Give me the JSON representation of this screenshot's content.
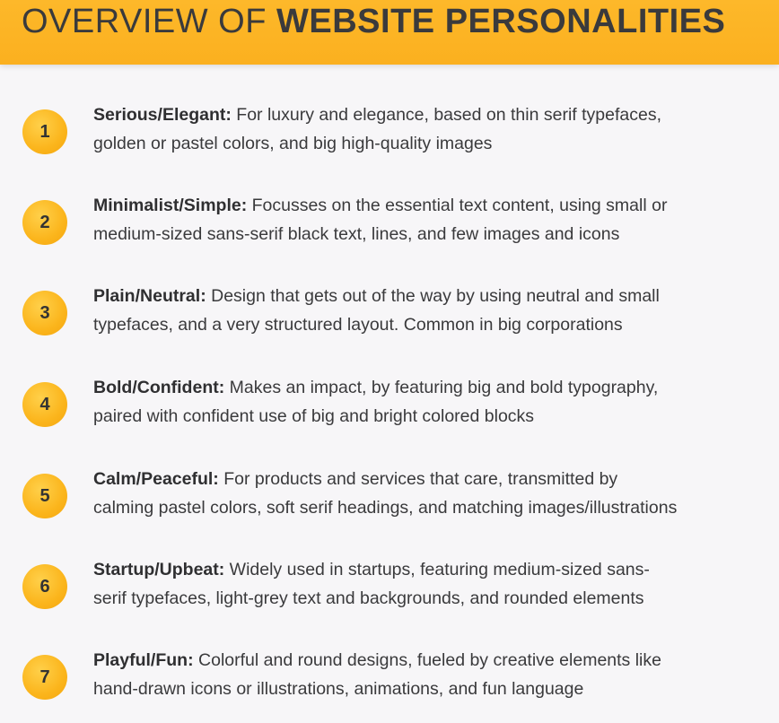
{
  "header": {
    "title_regular": "OVERVIEW OF",
    "title_bold": "WEBSITE PERSONALITIES",
    "background_color": "#fbb01f"
  },
  "items": [
    {
      "number": "1",
      "label": "Serious/Elegant:",
      "line1": "For luxury and elegance, based on thin serif typefaces,",
      "line2": "golden or pastel colors, and big high-quality images"
    },
    {
      "number": "2",
      "label": "Minimalist/Simple:",
      "line1": "Focusses on the essential text content, using small or",
      "line2": "medium-sized sans-serif black text, lines, and few images and icons"
    },
    {
      "number": "3",
      "label": "Plain/Neutral:",
      "line1": "Design that gets out of the way by using neutral and small",
      "line2": "typefaces, and a very structured layout. Common in big corporations"
    },
    {
      "number": "4",
      "label": "Bold/Confident:",
      "line1": "Makes an impact, by featuring big and bold typography,",
      "line2": "paired with confident use of big and bright colored blocks"
    },
    {
      "number": "5",
      "label": "Calm/Peaceful:",
      "line1": "For products and services that care, transmitted by",
      "line2": "calming pastel colors, soft serif headings, and matching images/illustrations"
    },
    {
      "number": "6",
      "label": "Startup/Upbeat:",
      "line1": "Widely used in startups, featuring medium-sized sans-",
      "line2": "serif typefaces, light-grey text and backgrounds, and rounded elements"
    },
    {
      "number": "7",
      "label": "Playful/Fun:",
      "line1": "Colorful and round designs, fueled by creative elements like",
      "line2": "hand-drawn icons or illustrations, animations, and fun language"
    }
  ]
}
